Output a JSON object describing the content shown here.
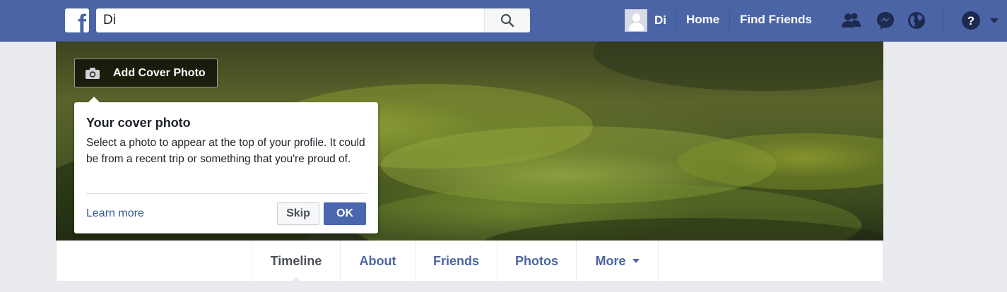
{
  "header": {
    "logo": "f",
    "search": {
      "value": "Di",
      "placeholder": "Search"
    },
    "profile_name": "Di",
    "nav": {
      "home": "Home",
      "find_friends": "Find Friends"
    },
    "icons": [
      "friend-requests-icon",
      "messenger-icon",
      "notifications-globe-icon",
      "help-icon",
      "account-menu-caret-icon"
    ],
    "colors": {
      "bar": "#4b64a5",
      "link": "#385898"
    }
  },
  "cover": {
    "add_cover_label": "Add Cover Photo"
  },
  "tooltip": {
    "title": "Your cover photo",
    "body": "Select a photo to appear at the top of your profile. It could be from a recent trip or something that you're proud of.",
    "learn_more": "Learn more",
    "skip": "Skip",
    "ok": "OK"
  },
  "tabs": [
    {
      "label": "Timeline",
      "active": true
    },
    {
      "label": "About"
    },
    {
      "label": "Friends"
    },
    {
      "label": "Photos"
    },
    {
      "label": "More"
    }
  ]
}
